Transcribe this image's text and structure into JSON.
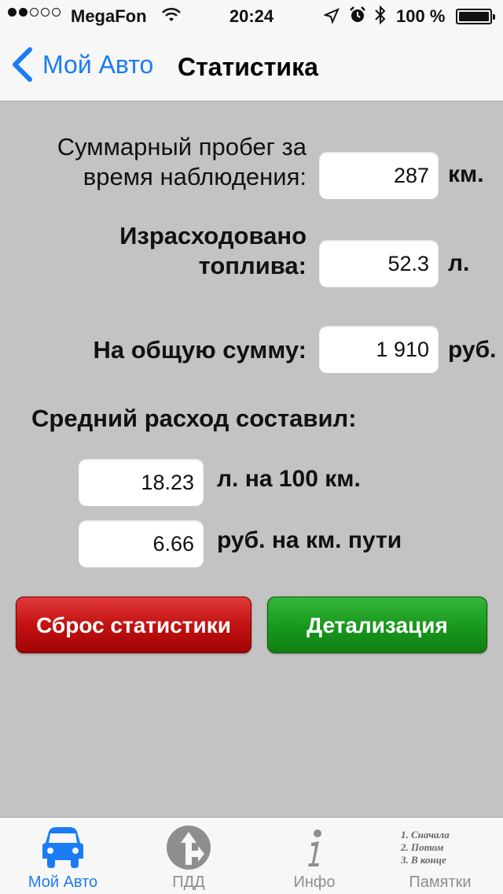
{
  "status_bar": {
    "carrier": "MegaFon",
    "time": "20:24",
    "battery": "100 %",
    "signal_dots_filled": 2,
    "signal_dots_total": 5
  },
  "nav": {
    "back_label": "Мой Авто",
    "title": "Статистика"
  },
  "stats": {
    "mileage_label_line1": "Суммарный пробег за",
    "mileage_label_line2": "время наблюдения:",
    "mileage_value": "287",
    "mileage_unit": "км.",
    "fuel_label_line1": "Израсходовано",
    "fuel_label_line2": "топлива:",
    "fuel_value": "52.3",
    "fuel_unit": "л.",
    "sum_label": "На общую сумму:",
    "sum_value": "1 910",
    "sum_unit": "руб."
  },
  "average": {
    "heading": "Средний расход составил:",
    "per100_value": "18.23",
    "per100_unit": "л. на 100 км.",
    "perkm_value": "6.66",
    "perkm_unit": "руб. на км. пути"
  },
  "buttons": {
    "reset": "Сброс статистики",
    "details": "Детализация"
  },
  "tabs": [
    {
      "label": "Мой Авто",
      "icon": "car-icon",
      "active": true
    },
    {
      "label": "ПДД",
      "icon": "road-sign-icon",
      "active": false
    },
    {
      "label": "Инфо",
      "icon": "info-icon",
      "active": false
    },
    {
      "label": "Памятки",
      "icon": "notes-icon",
      "active": false,
      "notes": [
        "1. Сначала",
        "2. Потом",
        "3. В конце"
      ]
    }
  ],
  "colors": {
    "accent": "#1a7cf5",
    "background": "#c3c3c3",
    "reset_button": "#c31212",
    "details_button": "#1a9a1f"
  }
}
